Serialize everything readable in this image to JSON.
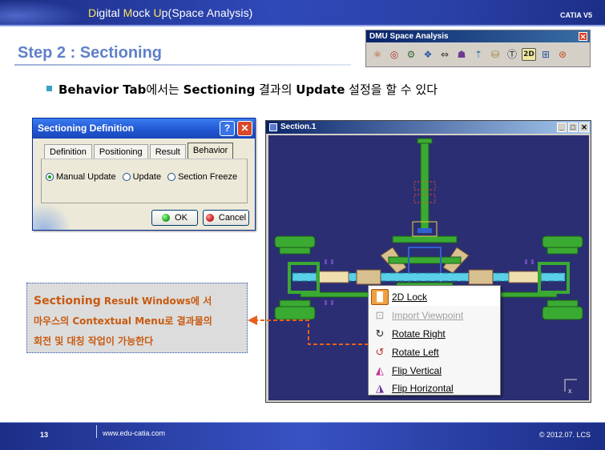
{
  "header": {
    "title_parts": [
      "D",
      "igital ",
      "M",
      "ock ",
      "U",
      "p(Space Analysis)"
    ],
    "brand": "CATIA V5"
  },
  "slide": {
    "step_title": "Step 2 : Sectioning",
    "bullet": {
      "part1": "Behavior Tab",
      "part2": "에서는 ",
      "part3": "Sectioning",
      "part4": " 결과의 ",
      "part5": "Update",
      "part6": " 설정을 할 수 있다"
    }
  },
  "dmu_toolbar": {
    "title": "DMU Space Analysis",
    "close_glyph": "✕",
    "icons": [
      "clash-icon",
      "distance-icon",
      "band-analysis-icon",
      "sectioning-icon",
      "compare-products-icon",
      "measure-between-icon",
      "measure-item-icon",
      "measure-thickness-icon",
      "annotated-view-icon",
      "3d-annotation-icon",
      "2d-text-icon",
      "view-annotation-icon",
      "arc-through-icon"
    ],
    "icon_glyphs": [
      "⚛",
      "◎",
      "⚙",
      "❖",
      "⇔",
      "☗",
      "⇡",
      "⛁",
      "Ⓣ",
      "2D",
      "⊞",
      "⊛"
    ]
  },
  "dialog": {
    "title": "Sectioning Definition",
    "help_glyph": "?",
    "close_glyph": "✕",
    "tabs": [
      "Definition",
      "Positioning",
      "Result",
      "Behavior"
    ],
    "active_tab": "Behavior",
    "radios": [
      "Manual Update",
      "Update",
      "Section Freeze"
    ],
    "selected_radio": "Manual Update",
    "ok_label": "OK",
    "cancel_label": "Cancel",
    "ok_led_color": "#22aa22",
    "cancel_led_color": "#cc2222"
  },
  "section_window": {
    "title": "Section.1",
    "btn_min": "_",
    "btn_max": "□",
    "btn_close": "✕",
    "axis_label": "x"
  },
  "context_menu": {
    "items": [
      {
        "label": "2D Lock",
        "icon": "lock-icon",
        "glyph": "🔒",
        "disabled": false
      },
      {
        "label": "Import Viewpoint",
        "icon": "import-viewpoint-icon",
        "glyph": "⊡",
        "disabled": true
      },
      {
        "label": "Rotate Right",
        "icon": "rotate-right-icon",
        "glyph": "↻",
        "disabled": false
      },
      {
        "label": "Rotate Left",
        "icon": "rotate-left-icon",
        "glyph": "↺",
        "disabled": false
      },
      {
        "label": "Flip Vertical",
        "icon": "flip-vertical-icon",
        "glyph": "◭",
        "disabled": false
      },
      {
        "label": "Flip Horizontal",
        "icon": "flip-horizontal-icon",
        "glyph": "◮",
        "disabled": false
      }
    ]
  },
  "callout": {
    "line1_a": "Sectioning",
    "line1_b": " Result Windows",
    "line1_c": "에 서",
    "line2_a": "마우스의 ",
    "line2_b": "Contextual Menu",
    "line2_c": "로 결과물의",
    "line3": "회전 및 대칭 작업이 가능한다"
  },
  "footer": {
    "page": "13",
    "url": "www.edu-catia.com",
    "copyright": "© 2012.07. LCS"
  },
  "colors": {
    "accent_orange": "#e8601a",
    "model_green": "#2f9b2a",
    "canvas_bg": "#2b2e73"
  }
}
